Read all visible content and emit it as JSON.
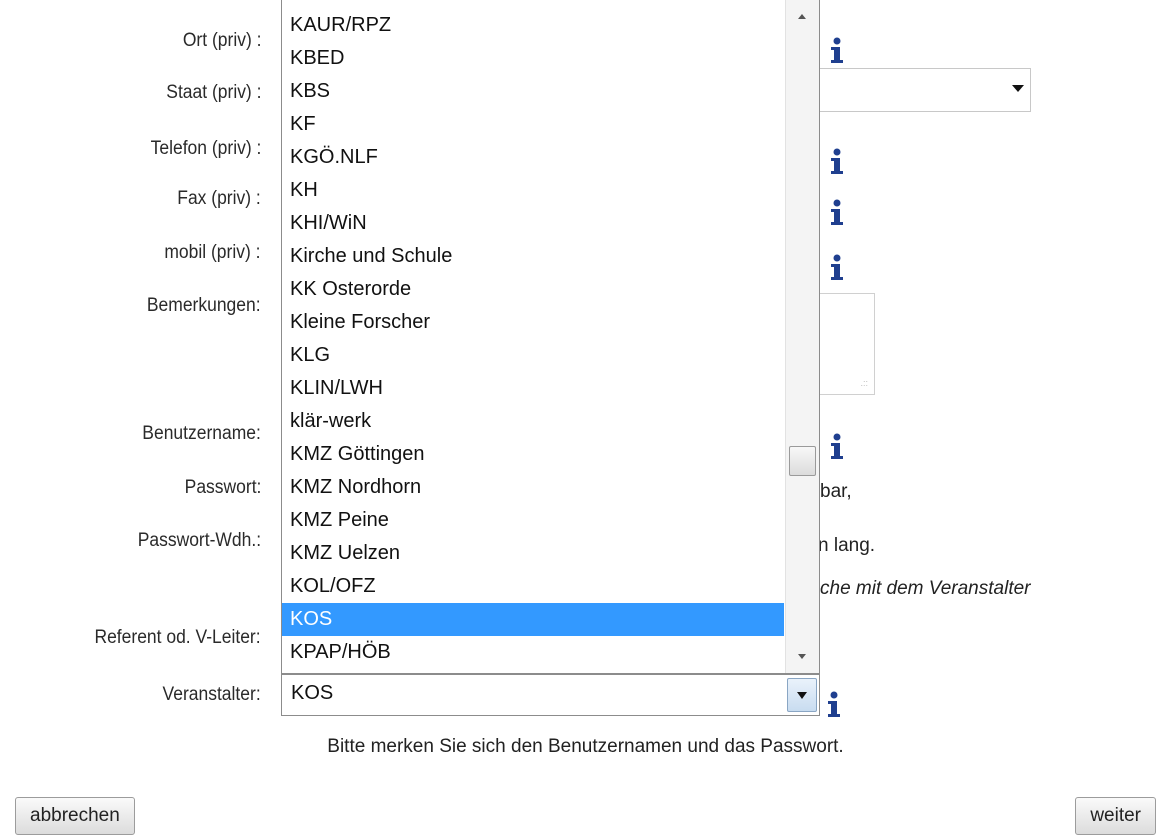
{
  "form": {
    "labels": {
      "ort": "Ort (priv) :",
      "staat": "Staat (priv) :",
      "telefon": "Telefon (priv) :",
      "fax": "Fax (priv) :",
      "mobil": "mobil (priv) :",
      "bemerkungen": "Bemerkungen:",
      "benutzername": "Benutzername:",
      "passwort": "Passwort:",
      "passwort_wdh": "Passwort-Wdh.:",
      "referent": "Referent od. V-Leiter:",
      "veranstalter": "Veranstalter:"
    },
    "hints": {
      "passwort_tail": "bar,",
      "passwort_wdh_tail": "n lang.",
      "referent_tail": "che mit dem Veranstalter"
    },
    "veranstalter_value": "KOS",
    "note": "Bitte merken Sie sich den Benutzernamen und das Passwort."
  },
  "dropdown": {
    "items": [
      "KAUR/RPZ",
      "KBED",
      "KBS",
      "KF",
      "KGÖ.NLF",
      "KH",
      "KHI/WiN",
      "Kirche und Schule",
      "KK Osterorde",
      "Kleine Forscher",
      "KLG",
      "KLIN/LWH",
      "klär-werk",
      "KMZ Göttingen",
      "KMZ Nordhorn",
      "KMZ Peine",
      "KMZ Uelzen",
      "KOL/OFZ",
      "KOS",
      "KPAP/HÖB"
    ],
    "selected_index": 18
  },
  "buttons": {
    "cancel": "abbrechen",
    "next": "weiter"
  },
  "colors": {
    "selection": "#3399ff",
    "info_icon": "#1f3f8f"
  }
}
